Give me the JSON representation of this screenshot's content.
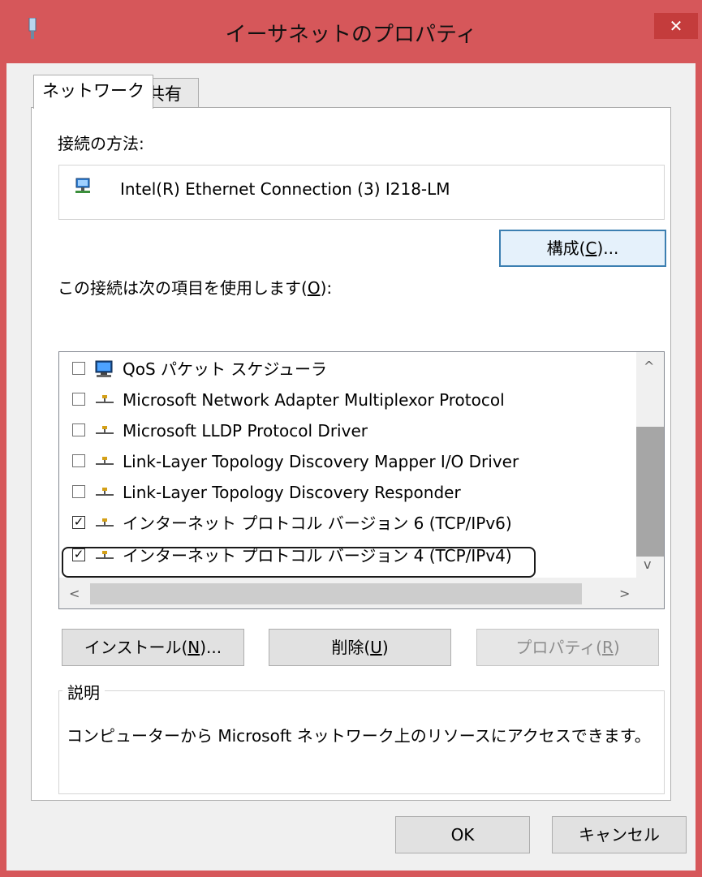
{
  "window": {
    "title": "イーサネットのプロパティ",
    "close_label": "✕"
  },
  "tabs": [
    {
      "label": "ネットワーク",
      "selected": true
    },
    {
      "label": "共有",
      "selected": false
    }
  ],
  "connect_using": {
    "label": "接続の方法:",
    "adapter": "Intel(R) Ethernet Connection (3) I218-LM",
    "configure_button": {
      "text": "構成(",
      "mnemonic": "C",
      "suffix": ")..."
    }
  },
  "items_section": {
    "label_text": "この接続は次の項目を使用します(",
    "label_mnemonic": "O",
    "label_suffix": "):",
    "items": [
      {
        "label": "QoS パケット スケジューラ",
        "checked": false,
        "icon": "qos-scheduler-icon"
      },
      {
        "label": "Microsoft Network Adapter Multiplexor Protocol",
        "checked": false,
        "icon": "protocol-icon"
      },
      {
        "label": "Microsoft LLDP Protocol Driver",
        "checked": false,
        "icon": "protocol-icon"
      },
      {
        "label": "Link-Layer Topology Discovery Mapper I/O Driver",
        "checked": false,
        "icon": "protocol-icon"
      },
      {
        "label": "Link-Layer Topology Discovery Responder",
        "checked": false,
        "icon": "protocol-icon"
      },
      {
        "label": "インターネット プロトコル バージョン 6 (TCP/IPv6)",
        "checked": true,
        "icon": "protocol-icon"
      },
      {
        "label": "インターネット プロトコル バージョン 4 (TCP/IPv4)",
        "checked": true,
        "icon": "protocol-icon",
        "highlighted": true
      }
    ],
    "check_mark": "✓"
  },
  "buttons": {
    "install": {
      "text": "インストール(",
      "mnemonic": "N",
      "suffix": ")..."
    },
    "uninstall": {
      "text": "削除(",
      "mnemonic": "U",
      "suffix": ")"
    },
    "properties": {
      "text": "プロパティ(",
      "mnemonic": "R",
      "suffix": ")",
      "disabled": true
    },
    "ok": "OK",
    "cancel": "キャンセル"
  },
  "description": {
    "title": "説明",
    "text": "コンピューターから Microsoft ネットワーク上のリソースにアクセスできます。"
  },
  "colors": {
    "title_bar": "#d6575a",
    "close_button": "#c43c3c",
    "focus_border": "#3c7fb1"
  }
}
